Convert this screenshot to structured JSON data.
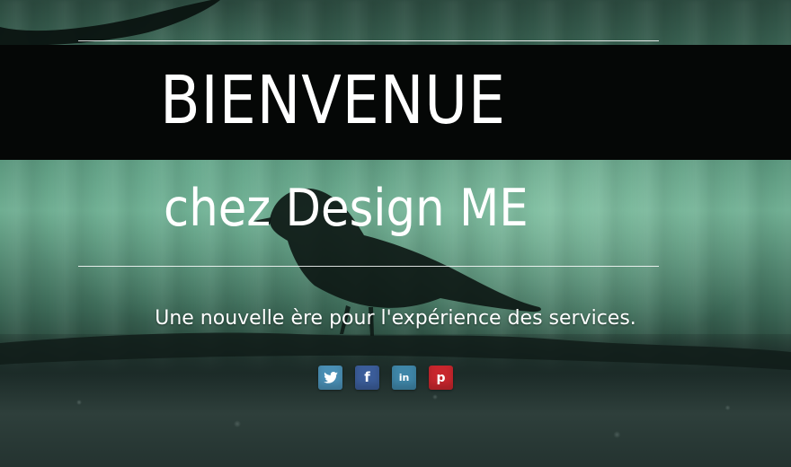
{
  "hero": {
    "title": "BIENVENUE",
    "subtitle": "chez Design ME",
    "tagline": "Une nouvelle ère pour l'expérience des services."
  },
  "social": [
    {
      "name": "twitter",
      "icon": "twitter-icon",
      "glyph": "",
      "color": "#4a8fb5"
    },
    {
      "name": "facebook",
      "icon": "facebook-icon",
      "glyph": "f",
      "color": "#3b5d9a"
    },
    {
      "name": "linkedin",
      "icon": "linkedin-icon",
      "glyph": "in",
      "color": "#3f86a8"
    },
    {
      "name": "pinterest",
      "icon": "pinterest-icon",
      "glyph": "p",
      "color": "#c8262d"
    }
  ],
  "colors": {
    "band": "#050706",
    "text": "#ffffff",
    "background_green": "#6fae92"
  }
}
